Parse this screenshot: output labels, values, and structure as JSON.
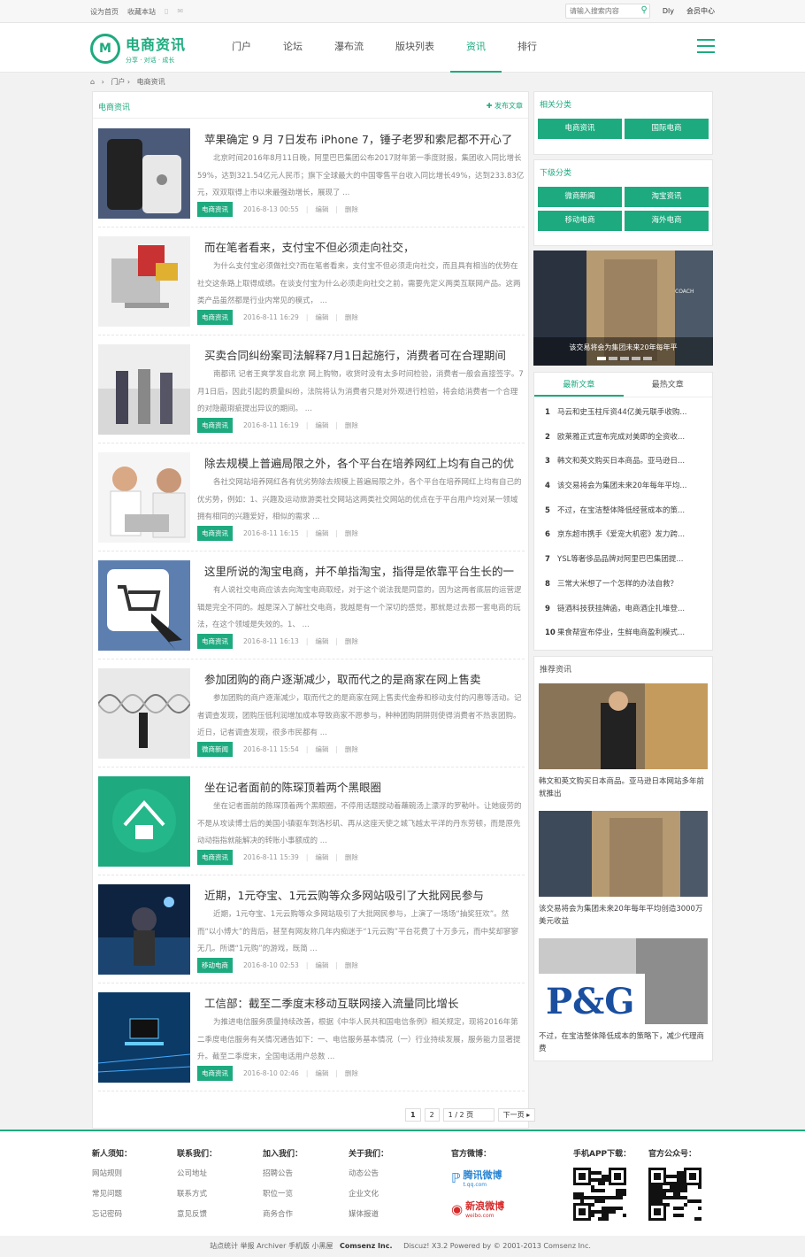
{
  "topbar": {
    "set_home": "设为首页",
    "bookmark": "收藏本站",
    "search_placeholder": "请输入搜索内容",
    "user": "Dly",
    "member_center": "会员中心"
  },
  "logo": {
    "title": "电商资讯",
    "subtitle": "分享 · 对话 · 成长"
  },
  "nav": [
    "门户",
    "论坛",
    "瀑布流",
    "版块列表",
    "资讯",
    "排行"
  ],
  "nav_active": "资讯",
  "breadcrumb": {
    "home": "门户",
    "sep": "›",
    "current": "电商资讯"
  },
  "main": {
    "title": "电商资讯",
    "post_button": "发布文章",
    "edit": "编辑",
    "delete": "删除",
    "articles": [
      {
        "title": "苹果确定 9 月 7日发布 iPhone 7，锤子老罗和索尼都不开心了",
        "desc": "北京时间2016年8月11日晚，阿里巴巴集团公布2017财年第一季度财报，集团收入同比增长59%，达到321.54亿元人民币；旗下全球最大的中国零售平台收入同比增长49%，达到233.83亿元，双双取得上市以来最强劲增长，展现了 ...",
        "tag": "电商资讯",
        "date": "2016-8-13 00:55"
      },
      {
        "title": "而在笔者看来，支付宝不但必须走向社交，",
        "desc": "为什么支付宝必须做社交?而在笔者看来，支付宝不但必须走向社交，而且具有相当的优势在社交这条路上取得成绩。在谈支付宝为什么必须走向社交之前，需要先定义两类互联网产品。这两类产品虽然都是行业内常见的模式， ...",
        "tag": "电商资讯",
        "date": "2016-8-11 16:29"
      },
      {
        "title": "买卖合同纠纷案司法解释7月1日起施行，消费者可在合理期间",
        "desc": "南都讯 记者王爽学发自北京 网上购物，收货时没有太多时间检验，消费者一般会直接签字。7月1日后，因此引起的质量纠纷，法院将认为消费者只是对外观进行检验，将会给消费者一个合理的对隐蔽瑕疵提出异议的期间。 ...",
        "tag": "电商资讯",
        "date": "2016-8-11 16:19"
      },
      {
        "title": "除去规模上普遍局限之外，各个平台在培养网红上均有自己的优",
        "desc": "各社交网站培养网红各有优劣势除去规模上普遍局限之外，各个平台在培养网红上均有自己的优劣势，例如：1、兴趣及运动旅游类社交网站这两类社交网站的优点在于平台用户均对某一领域拥有相同的兴趣爱好，相似的需求 ...",
        "tag": "电商资讯",
        "date": "2016-8-11 16:15"
      },
      {
        "title": "这里所说的淘宝电商，并不单指淘宝，指得是依靠平台生长的一",
        "desc": "有人说社交电商应该去向淘宝电商取经，对于这个说法我是同意的，因为这两者底层的运营逻辑是完全不同的。越是深入了解社交电商，我越是有一个深切的感觉，那就是过去那一套电商的玩法，在这个领域是失效的。1、 ...",
        "tag": "电商资讯",
        "date": "2016-8-11 16:13"
      },
      {
        "title": "参加团购的商户逐渐减少，取而代之的是商家在网上售卖",
        "desc": "参加团购的商户逐渐减少，取而代之的是商家在网上售卖代金券和移动支付的闪惠等活动。记者调查发现，团购压低利润增加成本导致商家不愿参与，种种团购阴阱则使得消费者不热衷团购。近日，记者调查发现，很多市民都有 ...",
        "tag": "微商新闻",
        "date": "2016-8-11 15:54"
      },
      {
        "title": "坐在记者面前的陈琛顶着两个黑眼圈",
        "desc": "坐在记者面前的陈琛顶着两个黑眼圈，不停用话题搅动着蘸碗汤上漂浮的罗勒叶。让她疲劳的不是从攻读博士后的美国小镇驱车到洛杉矶、再从这座天使之城飞越太平洋的丹东劳顿，而是原先动动指指就能解决的转账小事额成的 ...",
        "tag": "电商资讯",
        "date": "2016-8-11 15:39"
      },
      {
        "title": "近期，1元夺宝、1元云购等众多网站吸引了大批网民参与",
        "desc": "近期，1元夺宝、1元云购等众多网站吸引了大批网民参与，上演了一场场“抽奖狂欢”。然而“以小博大”的背后，甚至有网友称几年内痴迷于“1元云购”平台花费了十万多元，而中奖却寥寥无几。所谓“1元购”的游戏，既简 ...",
        "tag": "移动电商",
        "date": "2016-8-10 02:53"
      },
      {
        "title": "工信部：截至二季度末移动互联网接入流量同比增长",
        "desc": "为推进电信服务质量持续改善，根据《中华人民共和国电信条例》相关规定，现将2016年第二季度电信服务有关情况通告如下：一、电信服务基本情况（一）行业持续发展，服务能力显著提升。截至二季度末，全国电话用户总数 ...",
        "tag": "电商资讯",
        "date": "2016-8-10 02:46"
      }
    ]
  },
  "pager": {
    "p1": "1",
    "p2": "2",
    "input": "1",
    "total": "/ 2 页",
    "next": "下一页"
  },
  "sidebar": {
    "related_title": "相关分类",
    "related": [
      "电商资讯",
      "国际电商"
    ],
    "sub_title": "下级分类",
    "sub": [
      "微商新闻",
      "淘宝资讯",
      "移动电商",
      "海外电商"
    ],
    "slide_caption": "该交易将会为集团未来20年每年平",
    "tab_new": "最新文章",
    "tab_hot": "最热文章",
    "rank": [
      "马云和史玉柱斥资44亿美元联手收购...",
      "欧莱雅正式宣布完成对美即的全资收...",
      "韩文和英文购买日本商品。亚马逊日...",
      "该交易将会为集团未来20年每年平均...",
      "不过，在宝洁整体降低经营成本的策...",
      "京东超市携手《爱宠大机密》发力跨...",
      "YSL等奢侈品品牌对阿里巴巴集团提...",
      "三常大米想了一个怎样的办法自救？",
      "链酒科技获挂牌函，电商酒企扎堆登...",
      "果食帮宣布停业，生鲜电商盈利模式..."
    ],
    "rec_title": "推荐资讯",
    "rec": [
      "韩文和英文购买日本商品。亚马逊日本网站多年前就推出",
      "该交易将会为集团未来20年每年平均创造3000万美元收益",
      "不过，在宝洁整体降低成本的策略下，减少代理商费"
    ]
  },
  "footer": {
    "cols": [
      {
        "h": "新人须知：",
        "links": [
          "网站规则",
          "常见问题",
          "忘记密码"
        ]
      },
      {
        "h": "联系我们：",
        "links": [
          "公司地址",
          "联系方式",
          "意见反馈"
        ]
      },
      {
        "h": "加入我们：",
        "links": [
          "招聘公告",
          "职位一览",
          "商务合作"
        ]
      },
      {
        "h": "关于我们：",
        "links": [
          "动态公告",
          "企业文化",
          "媒体报道"
        ]
      }
    ],
    "weibo_title": "官方微博：",
    "tencent_weibo": "腾讯微博",
    "tencent_url": "t.qq.com",
    "sina_weibo": "新浪微博",
    "sina_url": "weibo.com",
    "app_title": "手机APP下载：",
    "wx_title": "官方公众号："
  },
  "copyright": [
    "站点统计",
    "举报",
    "Archiver",
    "手机版",
    "小黑屋",
    "Comsenz Inc.",
    "Discuz! X3.2 Powered by © 2001-2013 Comsenz Inc."
  ],
  "colors": {
    "accent": "#1eaa7f"
  }
}
